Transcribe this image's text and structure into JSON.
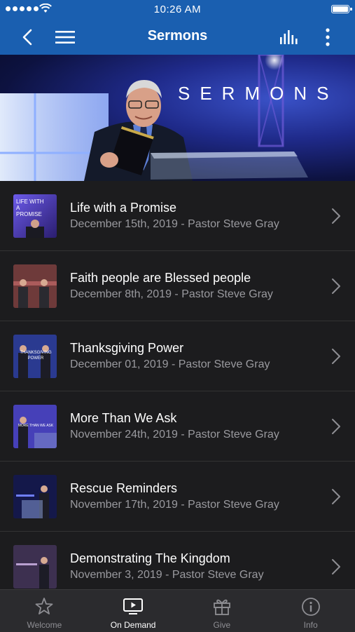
{
  "status_bar": {
    "time": "10:26 AM"
  },
  "nav": {
    "title": "Sermons",
    "back_icon": "back-chevron-icon",
    "menu_icon": "hamburger-menu-icon",
    "audio_icon": "audio-levels-icon",
    "more_icon": "more-vertical-icon"
  },
  "hero": {
    "text": "SERMONS"
  },
  "sermons": [
    {
      "title": "Life with a Promise",
      "subtitle": "December 15th, 2019 - Pastor Steve Gray",
      "thumb_text": "LIFE WITH A PROMISE"
    },
    {
      "title": "Faith people are Blessed people",
      "subtitle": "December 8th, 2019 - Pastor Steve Gray"
    },
    {
      "title": "Thanksgiving Power",
      "subtitle": "December 01, 2019 - Pastor Steve Gray",
      "thumb_text": "THANKSGIVING POWER"
    },
    {
      "title": "More Than We Ask",
      "subtitle": "November 24th, 2019 - Pastor Steve Gray",
      "thumb_text": "MORE THAN WE ASK"
    },
    {
      "title": "Rescue Reminders",
      "subtitle": "November 17th, 2019 - Pastor Steve Gray"
    },
    {
      "title": "Demonstrating The Kingdom",
      "subtitle": "November 3, 2019 - Pastor Steve Gray"
    }
  ],
  "tabs": [
    {
      "label": "Welcome",
      "icon": "star-icon"
    },
    {
      "label": "On Demand",
      "icon": "tv-play-icon",
      "active": true
    },
    {
      "label": "Give",
      "icon": "gift-icon"
    },
    {
      "label": "Info",
      "icon": "info-icon"
    }
  ],
  "colors": {
    "nav_blue": "#1a5fb0",
    "list_bg": "#1c1c1e",
    "tab_bg": "#2b2b2e",
    "subtitle": "#9a9a9f"
  }
}
